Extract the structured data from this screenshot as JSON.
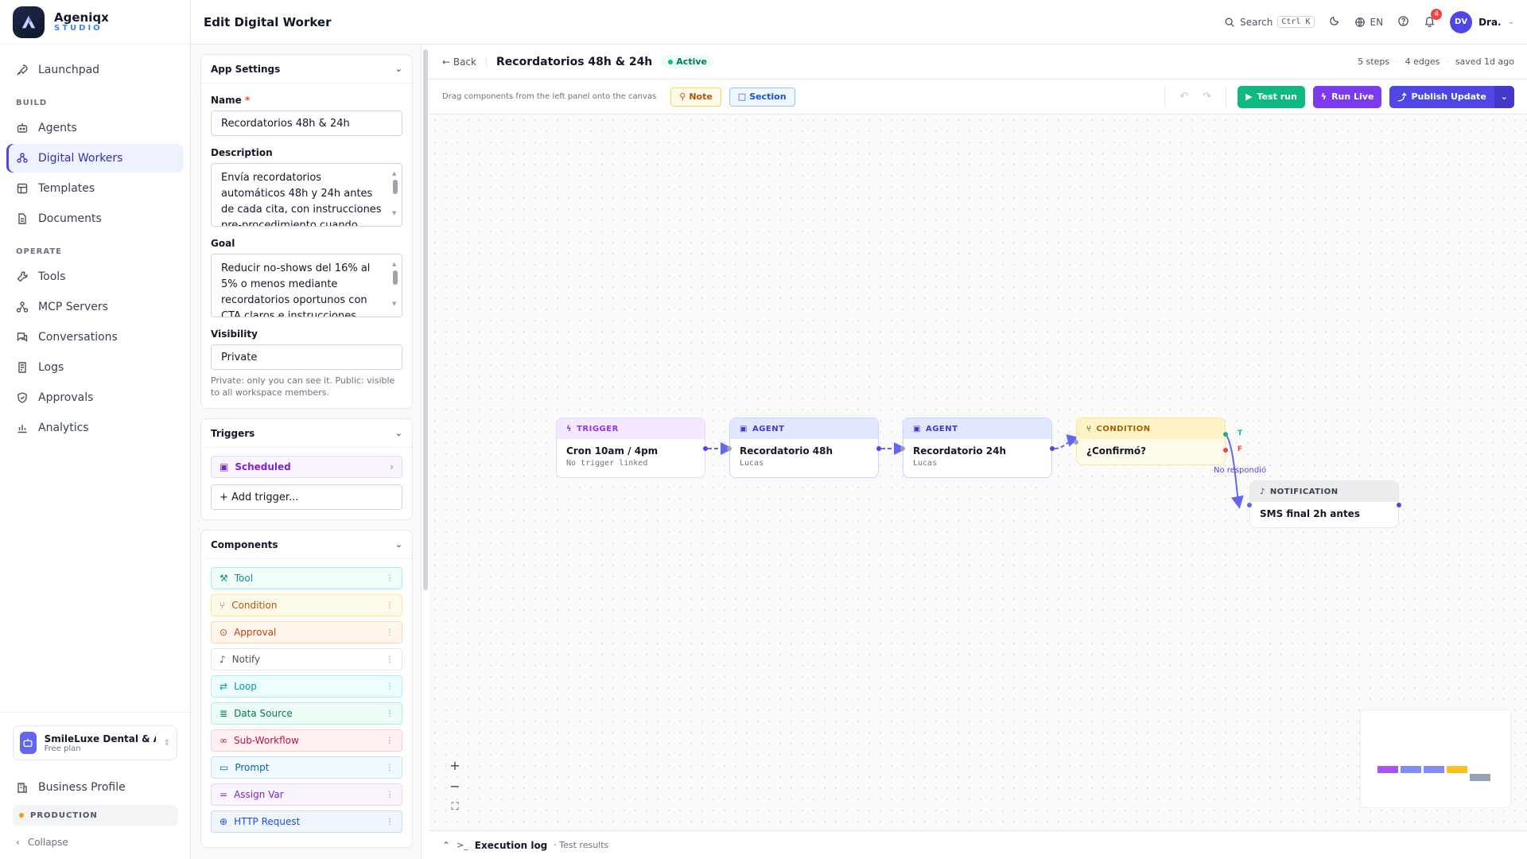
{
  "brand": {
    "name": "Ageniqx",
    "sub": "STUDIO"
  },
  "nav": {
    "launchpad": "Launchpad",
    "build_label": "BUILD",
    "agents": "Agents",
    "digital_workers": "Digital Workers",
    "templates": "Templates",
    "documents": "Documents",
    "operate_label": "OPERATE",
    "tools": "Tools",
    "mcp_servers": "MCP Servers",
    "conversations": "Conversations",
    "logs": "Logs",
    "approvals": "Approvals",
    "analytics": "Analytics"
  },
  "org": {
    "name": "SmileLuxe Dental & Ae...",
    "plan": "Free plan"
  },
  "sidebar_bottom": {
    "business_profile": "Business Profile",
    "environment": "PRODUCTION",
    "collapse": "Collapse"
  },
  "header": {
    "title": "Edit Digital Worker",
    "search_label": "Search",
    "search_kbd": "Ctrl K",
    "language": "EN",
    "notification_count": "4",
    "user_initials": "DV",
    "user_name": "Dra."
  },
  "app_settings": {
    "title": "App Settings",
    "name_label": "Name",
    "name_required": "*",
    "name_value": "Recordatorios 48h & 24h",
    "description_label": "Description",
    "description_value": "Envía recordatorios automáticos 48h y 24h antes de cada cita, con instrucciones pre-procedimiento cuando",
    "goal_label": "Goal",
    "goal_value": "Reducir no-shows del 16% al 5% o menos mediante recordatorios oportunos con CTA claros e instrucciones",
    "visibility_label": "Visibility",
    "visibility_value": "Private",
    "visibility_help": "Private: only you can see it. Public: visible to all workspace members."
  },
  "triggers": {
    "title": "Triggers",
    "scheduled": "Scheduled",
    "add": "+ Add trigger..."
  },
  "components": {
    "title": "Components",
    "items": [
      {
        "label": "Tool",
        "color": "#0d9488",
        "bg": "#f0fdfa",
        "border": "#99f6e4",
        "icon": "wrench-icon",
        "glyph": "⚒"
      },
      {
        "label": "Condition",
        "color": "#b45309",
        "bg": "#fffbeb",
        "border": "#fde68a",
        "icon": "branch-icon",
        "glyph": "⑂"
      },
      {
        "label": "Approval",
        "color": "#c2410c",
        "bg": "#fff7ed",
        "border": "#fed7aa",
        "icon": "check-circle-icon",
        "glyph": "⊙"
      },
      {
        "label": "Notify",
        "color": "#4b5563",
        "bg": "#ffffff",
        "border": "#e5e7eb",
        "icon": "bell-icon",
        "glyph": "♪"
      },
      {
        "label": "Loop",
        "color": "#0891b2",
        "bg": "#ecfeff",
        "border": "#a5f3fc",
        "icon": "repeat-icon",
        "glyph": "⇄"
      },
      {
        "label": "Data Source",
        "color": "#047857",
        "bg": "#ecfdf5",
        "border": "#a7f3d0",
        "icon": "database-icon",
        "glyph": "≣"
      },
      {
        "label": "Sub-Workflow",
        "color": "#be123c",
        "bg": "#fff1f2",
        "border": "#fecdd3",
        "icon": "link-icon",
        "glyph": "∞"
      },
      {
        "label": "Prompt",
        "color": "#0369a1",
        "bg": "#f0f9ff",
        "border": "#bae6fd",
        "icon": "chat-icon",
        "glyph": "▭"
      },
      {
        "label": "Assign Var",
        "color": "#7e22ce",
        "bg": "#faf5ff",
        "border": "#e9d5ff",
        "icon": "equals-icon",
        "glyph": "="
      },
      {
        "label": "HTTP Request",
        "color": "#1d4ed8",
        "bg": "#eff6ff",
        "border": "#bfdbfe",
        "icon": "globe-icon",
        "glyph": "⊕"
      }
    ]
  },
  "editor": {
    "back": "← Back",
    "workflow_title": "Recordatorios 48h & 24h",
    "status": "Active",
    "steps": "5 steps",
    "edges": "4 edges",
    "saved": "saved 1d ago",
    "hint": "Drag components from the left panel onto the canvas",
    "note_chip": "Note",
    "section_chip": "Section",
    "test_run": "Test run",
    "run_live": "Run Live",
    "publish": "Publish Update"
  },
  "nodes": {
    "trigger": {
      "kind": "TRIGGER",
      "title": "Cron 10am / 4pm",
      "sub": "No trigger linked",
      "accent": "#9333ea"
    },
    "agent1": {
      "kind": "AGENT",
      "title": "Recordatorio 48h",
      "sub": "Lucas",
      "accent": "#4f46e5"
    },
    "agent2": {
      "kind": "AGENT",
      "title": "Recordatorio 24h",
      "sub": "Lucas",
      "accent": "#4f46e5"
    },
    "condition": {
      "kind": "CONDITION",
      "title": "¿Confirmó?",
      "accent": "#a16207",
      "true_label": "T",
      "false_label": "F"
    },
    "notification": {
      "kind": "NOTIFICATION",
      "title": "SMS final 2h antes",
      "accent": "#374151"
    }
  },
  "edge_label": "No respondió",
  "footer": {
    "title": "Execution log",
    "sub": "· Test results"
  }
}
